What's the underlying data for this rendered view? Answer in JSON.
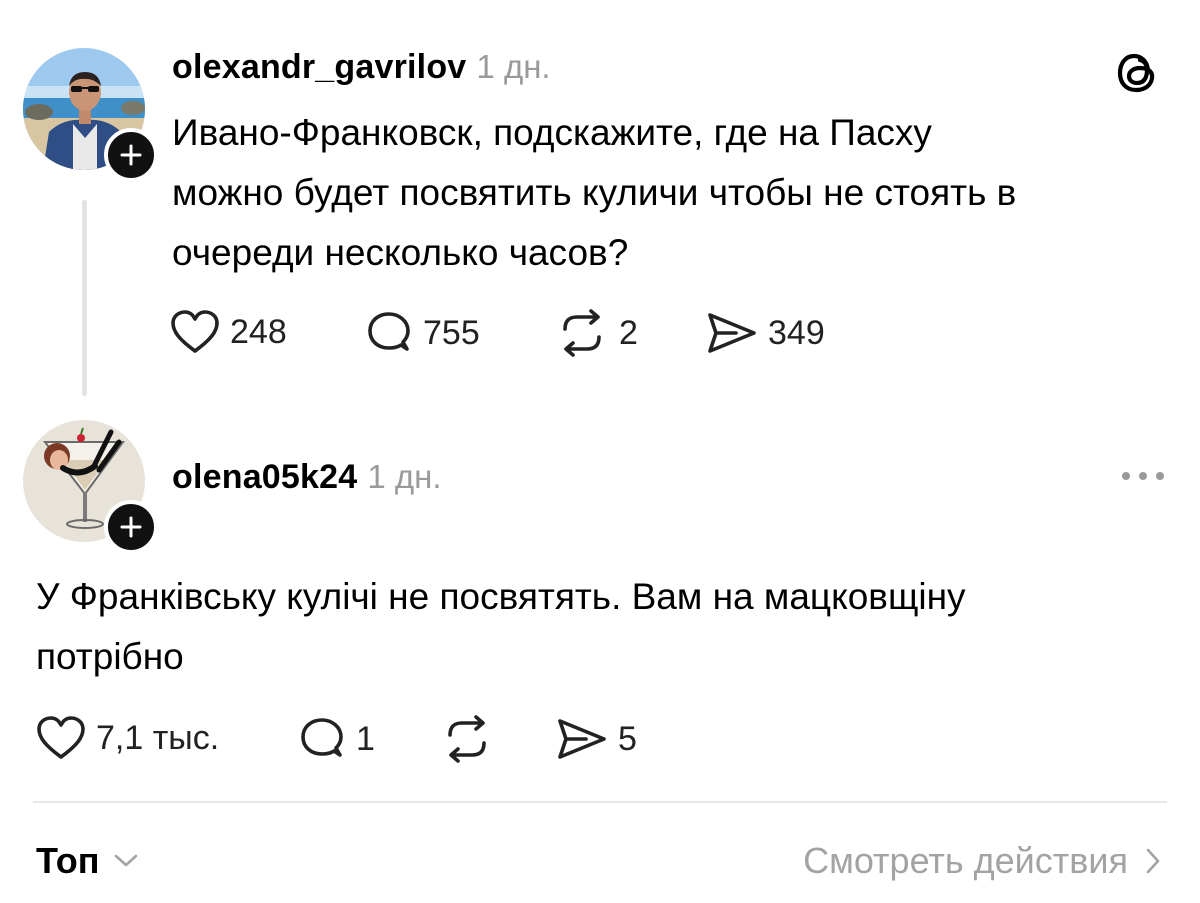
{
  "posts": [
    {
      "username": "olexandr_gavrilov",
      "time": "1 дн.",
      "text_lines": [
        "Ивано-Франковск, подскажите, где на Пасху",
        "можно будет посвятить куличи чтобы не стоять в",
        "очереди несколько часов?"
      ],
      "likes": "248",
      "replies": "755",
      "reposts": "2",
      "shares": "349",
      "corner_icon": "threads-logo-icon"
    },
    {
      "username": "olena05k24",
      "time": "1 дн.",
      "text_lines": [
        "У Франківську кулічі не посвятять. Вам на мацковщіну",
        "потрібно"
      ],
      "likes": "7,1 тыс.",
      "replies": "1",
      "reposts": "",
      "shares": "5",
      "corner_icon": "more-options-icon"
    }
  ],
  "footer": {
    "sort_label": "Топ",
    "view_activity_label": "Смотреть действия"
  },
  "colors": {
    "text": "#000000",
    "muted": "#9a9a9a",
    "divider": "#e6e6e6",
    "plus_badge": "#111111"
  }
}
